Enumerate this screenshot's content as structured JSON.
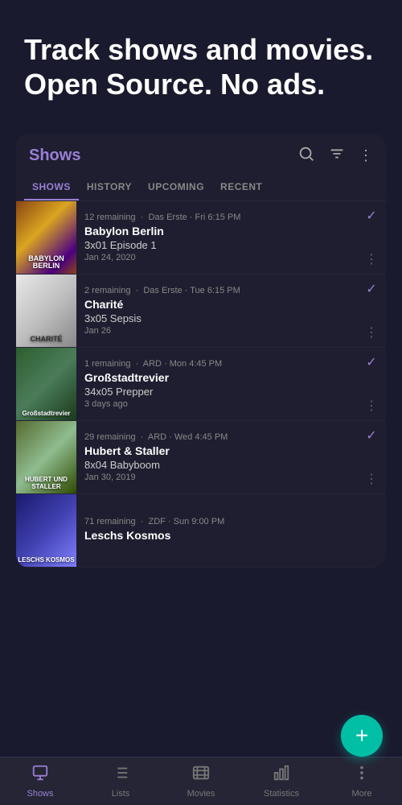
{
  "hero": {
    "title": "Track shows and movies. Open Source. No ads."
  },
  "card": {
    "title": "Shows",
    "tabs": [
      {
        "label": "SHOWS",
        "active": true
      },
      {
        "label": "HISTORY",
        "active": false
      },
      {
        "label": "UPCOMING",
        "active": false
      },
      {
        "label": "RECENT",
        "active": false
      }
    ],
    "shows": [
      {
        "id": "babylon-berlin",
        "poster_class": "poster-babylon",
        "poster_label": "BABYLON BERLIN",
        "remaining": "12 remaining",
        "channel": "Das Erste",
        "time": "Fri 6:15 PM",
        "name": "Babylon Berlin",
        "episode": "3x01 Episode 1",
        "date": "Jan 24, 2020"
      },
      {
        "id": "charite",
        "poster_class": "poster-charite",
        "poster_label": "CHARITÉ",
        "remaining": "2 remaining",
        "channel": "Das Erste",
        "time": "Tue 6:15 PM",
        "name": "Charité",
        "episode": "3x05 Sepsis",
        "date": "Jan 26"
      },
      {
        "id": "grossstadtrevier",
        "poster_class": "poster-grossstadt",
        "poster_label": "Großstadtrevier",
        "remaining": "1 remaining",
        "channel": "ARD",
        "time": "Mon 4:45 PM",
        "name": "Großstadtrevier",
        "episode": "34x05 Prepper",
        "date": "3 days ago"
      },
      {
        "id": "hubert-staller",
        "poster_class": "poster-hubert",
        "poster_label": "HUBERT UND STALLER",
        "remaining": "29 remaining",
        "channel": "ARD",
        "time": "Wed 4:45 PM",
        "name": "Hubert & Staller",
        "episode": "8x04 Babyboom",
        "date": "Jan 30, 2019"
      },
      {
        "id": "leschs-kosmos",
        "poster_class": "poster-leschs",
        "poster_label": "LESCHS KOSMOS",
        "remaining": "71 remaining",
        "channel": "ZDF",
        "time": "Sun 9:00 PM",
        "name": "Leschs Kosmos",
        "episode": "",
        "date": ""
      }
    ]
  },
  "fab": {
    "label": "+"
  },
  "bottom_nav": [
    {
      "id": "shows",
      "label": "Shows",
      "active": true
    },
    {
      "id": "lists",
      "label": "Lists",
      "active": false
    },
    {
      "id": "movies",
      "label": "Movies",
      "active": false
    },
    {
      "id": "statistics",
      "label": "Statistics",
      "active": false
    },
    {
      "id": "more",
      "label": "More",
      "active": false
    }
  ]
}
